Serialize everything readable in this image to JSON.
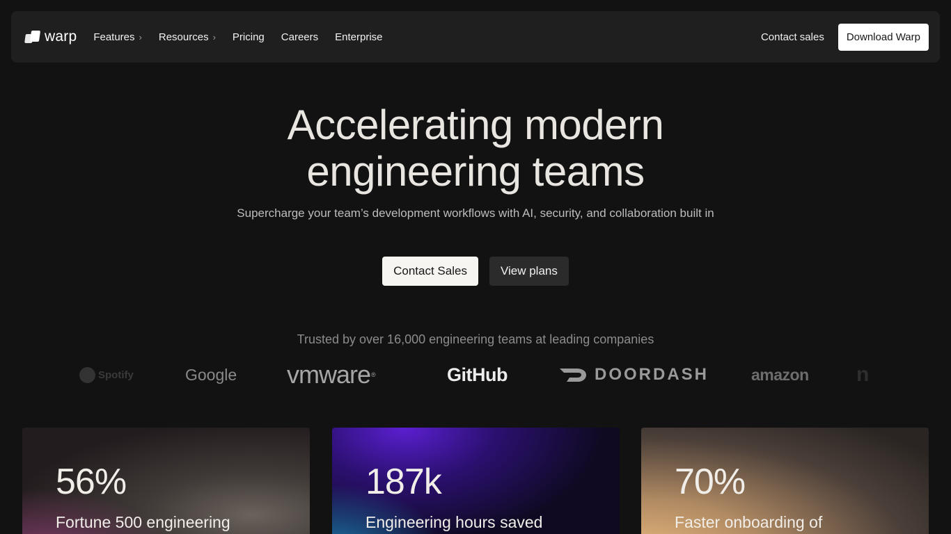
{
  "nav": {
    "logo_text": "warp",
    "links": [
      {
        "label": "Features",
        "has_chevron": true
      },
      {
        "label": "Resources",
        "has_chevron": true
      },
      {
        "label": "Pricing"
      },
      {
        "label": "Careers"
      },
      {
        "label": "Enterprise"
      }
    ],
    "contact_label": "Contact sales",
    "download_label": "Download Warp"
  },
  "hero": {
    "title_line1": "Accelerating modern",
    "title_line2": "engineering teams",
    "subtitle": "Supercharge your team’s development workflows with AI, security, and collaboration built in",
    "primary_cta": "Contact Sales",
    "secondary_cta": "View plans"
  },
  "trusted": {
    "text": "Trusted by over 16,000 engineering teams at leading companies",
    "companies": [
      "Spotify",
      "Google",
      "vmware",
      "GitHub",
      "DOORDASH",
      "amazon"
    ]
  },
  "stats": [
    {
      "value": "56%",
      "label": "Fortune 500 engineering"
    },
    {
      "value": "187k",
      "label": "Engineering hours saved"
    },
    {
      "value": "70%",
      "label": "Faster onboarding of"
    }
  ],
  "icons": {
    "chevron": "chevron-right-icon",
    "logo": "warp-logo-icon"
  }
}
